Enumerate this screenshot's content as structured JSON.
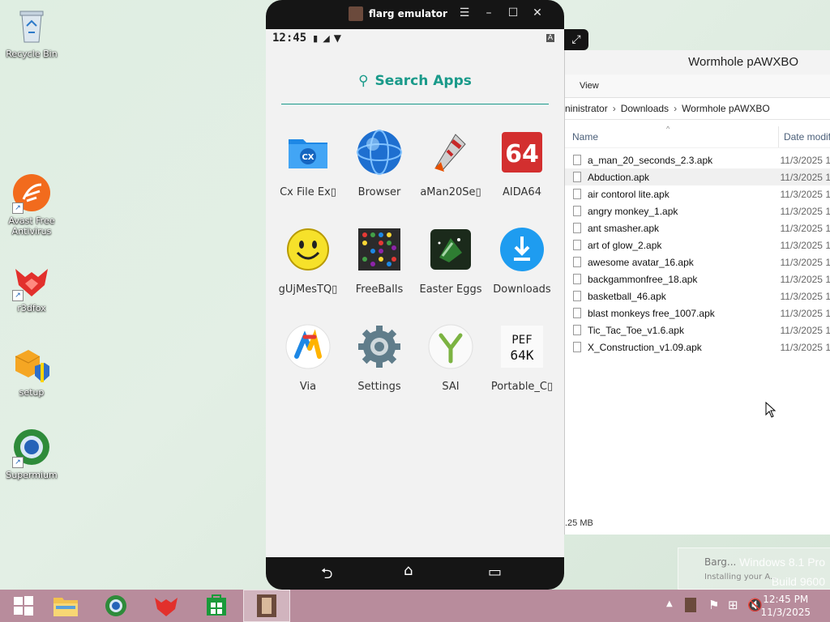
{
  "desktop": {
    "icons": [
      {
        "label": "Recycle Bin"
      },
      {
        "label": "Avast Free Antivirus"
      },
      {
        "label": "r3dfox"
      },
      {
        "label": "setup"
      },
      {
        "label": "Supermium"
      }
    ]
  },
  "explorer": {
    "title": "Wormhole pAWXBO",
    "ribbon_tab": "View",
    "breadcrumb": [
      "ninistrator",
      "Downloads",
      "Wormhole pAWXBO"
    ],
    "columns": {
      "name": "Name",
      "date": "Date modif"
    },
    "files": [
      {
        "name": "a_man_20_seconds_2.3.apk",
        "date": "11/3/2025 1"
      },
      {
        "name": "Abduction.apk",
        "date": "11/3/2025 1"
      },
      {
        "name": "air contorol lite.apk",
        "date": "11/3/2025 1"
      },
      {
        "name": "angry monkey_1.apk",
        "date": "11/3/2025 1"
      },
      {
        "name": "ant smasher.apk",
        "date": "11/3/2025 1"
      },
      {
        "name": "art of glow_2.apk",
        "date": "11/3/2025 1"
      },
      {
        "name": "awesome avatar_16.apk",
        "date": "11/3/2025 1"
      },
      {
        "name": "backgammonfree_18.apk",
        "date": "11/3/2025 1"
      },
      {
        "name": "basketball_46.apk",
        "date": "11/3/2025 1"
      },
      {
        "name": "blast monkeys free_1007.apk",
        "date": "11/3/2025 1"
      },
      {
        "name": "Tic_Tac_Toe_v1.6.apk",
        "date": "11/3/2025 1"
      },
      {
        "name": "X_Construction_v1.09.apk",
        "date": "11/3/2025 1"
      }
    ],
    "status": ".25 MB"
  },
  "emulator": {
    "title": "flarg emulator",
    "time": "12:45",
    "search_label": "Search Apps",
    "apps": [
      {
        "label": "Cx File Ex▯",
        "icon": "cx-file-explorer-icon"
      },
      {
        "label": "Browser",
        "icon": "browser-globe-icon"
      },
      {
        "label": "aMan20Se▯",
        "icon": "rocket-game-icon"
      },
      {
        "label": "AIDA64",
        "icon": "aida64-icon"
      },
      {
        "label": "gUjMesTQ▯",
        "icon": "smiley-icon"
      },
      {
        "label": "FreeBalls",
        "icon": "freeballs-icon"
      },
      {
        "label": "Easter Eggs",
        "icon": "easter-eggs-icon"
      },
      {
        "label": "Downloads",
        "icon": "downloads-icon"
      },
      {
        "label": "Via",
        "icon": "via-browser-icon"
      },
      {
        "label": "Settings",
        "icon": "settings-gear-icon"
      },
      {
        "label": "SAI",
        "icon": "sai-installer-icon"
      },
      {
        "label": "Portable_C▯",
        "icon": "portable-c64-icon"
      }
    ]
  },
  "taskbar": {
    "clock_time": "12:45 PM",
    "clock_date": "11/3/2025",
    "watermark_line1": "Windows 8.1 Pro",
    "watermark_line2": "Build 9600",
    "toast_line1": "Barg...",
    "toast_line2": "Installing your A..."
  },
  "colors": {
    "accent": "#1a9a8a",
    "taskbar": "#b88c9c"
  }
}
